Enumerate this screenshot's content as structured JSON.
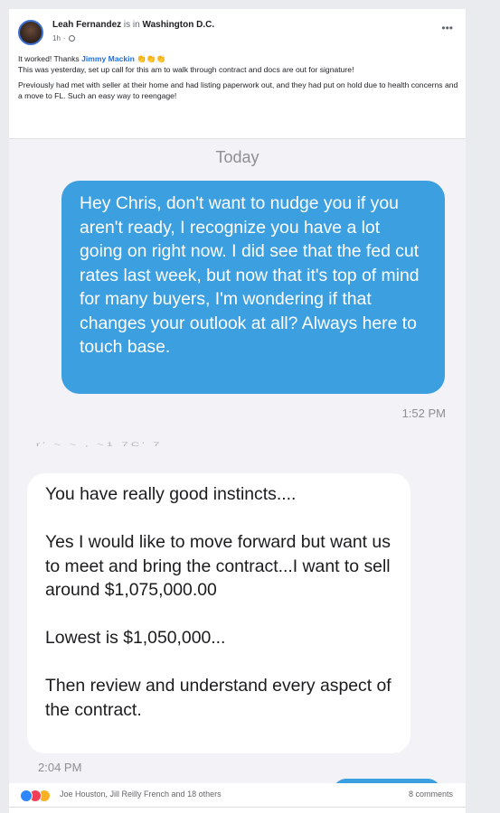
{
  "post": {
    "author": "Leah Fernandez",
    "is_in": "is in",
    "location": "Washington D.C.",
    "time": "1h",
    "text_line1_before": "It worked! Thanks",
    "mention": "Jimmy Mackin",
    "clap_emoji": "👏👏👏",
    "text_line2": "This was yesterday, set up call for this am to walk through contract and docs are out for signature!",
    "text_line3": "Previously had met with seller at their home and had listing paperwork out, and they had put on hold due to health concerns and a move to FL.  Such an easy way to reengage!"
  },
  "conversation": {
    "date_label": "Today",
    "outgoing_message": "Hey Chris, don't want to nudge you if you aren't ready, I recognize you have a lot going on right now. I did see that the fed cut rates last week, but now that it's top of mind for many buyers, I'm wondering if that changes your outlook at all?  Always here to touch base.",
    "outgoing_time": "1:52 PM",
    "cut_fragment": "r' ~ ~ , ~1 7C'   7",
    "incoming_paragraphs": [
      "You have really good instincts....",
      "Yes I would like to move forward but want us to meet and bring the contract...I want to sell around $1,075,000.00",
      "Lowest is $1,050,000...",
      "Then review and understand every aspect of the contract."
    ],
    "incoming_time": "2:04 PM"
  },
  "footer": {
    "reaction_icons": [
      "like-icon",
      "love-icon",
      "wow-icon"
    ],
    "reactors": "Joe Houston, Jill Reilly French and 18 others",
    "comments": "8 comments"
  },
  "colors": {
    "outgoing_bubble": "#3b9fe0",
    "incoming_bubble": "#ffffff",
    "thread_background": "#f2f2f7",
    "mention": "#216fdb"
  }
}
